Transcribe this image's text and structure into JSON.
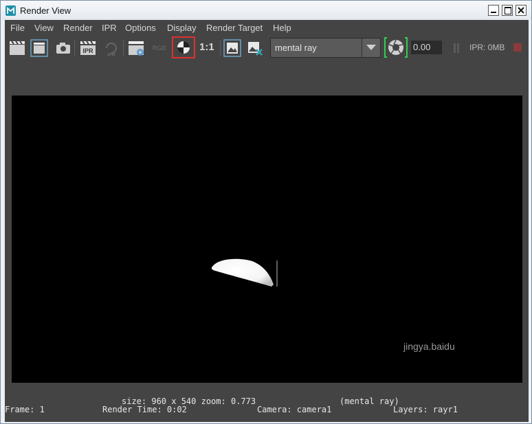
{
  "window": {
    "title": "Render View"
  },
  "menu": {
    "items": [
      "File",
      "View",
      "Render",
      "IPR",
      "Options",
      "Display",
      "Render Target",
      "Help"
    ]
  },
  "toolbar": {
    "ratio_label": "1:1",
    "renderer": "mental ray",
    "exposure_value": "0.00",
    "ipr_memory": "IPR: 0MB",
    "rgb_label": "RGB",
    "ipr_label": "IPR"
  },
  "status": {
    "size_zoom": "size: 960 x 540 zoom: 0.773",
    "renderer": "(mental ray)",
    "frame": "Frame: 1",
    "render_time": "Render Time: 0:02",
    "camera": "Camera: camera1",
    "layers": "Layers: rayr1"
  },
  "watermark": "jingya.baidu",
  "colors": {
    "highlight": "#e03030",
    "accent_green": "#33cc55",
    "ipr_stop": "#cc3333"
  }
}
